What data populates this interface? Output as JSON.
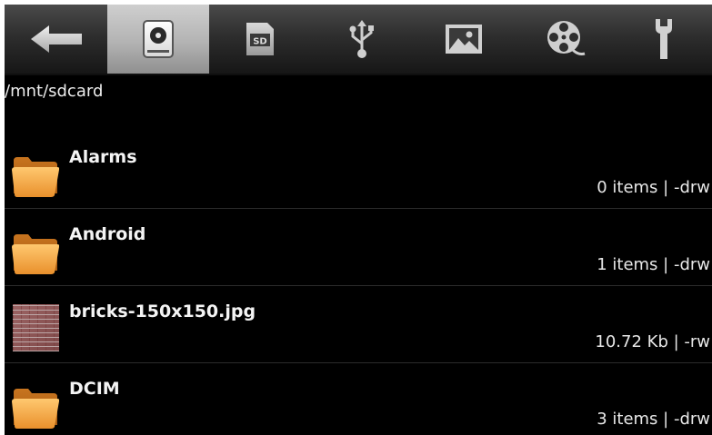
{
  "toolbar": {
    "items": [
      {
        "name": "back",
        "icon": "back-arrow-icon"
      },
      {
        "name": "internal-storage",
        "icon": "hard-drive-icon",
        "active": true
      },
      {
        "name": "sd-card",
        "icon": "sd-card-icon",
        "icon_text": "SD"
      },
      {
        "name": "usb",
        "icon": "usb-icon"
      },
      {
        "name": "images",
        "icon": "image-icon"
      },
      {
        "name": "videos",
        "icon": "film-reel-icon"
      },
      {
        "name": "tools",
        "icon": "wrench-icon"
      }
    ],
    "active_color": "#c4c4c4"
  },
  "current_path": "/mnt/sdcard",
  "files": [
    {
      "name": "Alarms",
      "type": "folder",
      "icon": "folder-icon",
      "meta": "0 items | -drw"
    },
    {
      "name": "Android",
      "type": "folder",
      "icon": "folder-icon",
      "meta": "1 items | -drw"
    },
    {
      "name": "bricks-150x150.jpg",
      "type": "image",
      "icon": "image-thumbnail",
      "meta": "10.72 Kb  | -rw"
    },
    {
      "name": "DCIM",
      "type": "folder",
      "icon": "folder-icon",
      "meta": "3 items | -drw"
    }
  ],
  "colors": {
    "background": "#000000",
    "text": "#f4f4f4",
    "folder": "#f2a64a",
    "divider": "#2b2b2b"
  }
}
